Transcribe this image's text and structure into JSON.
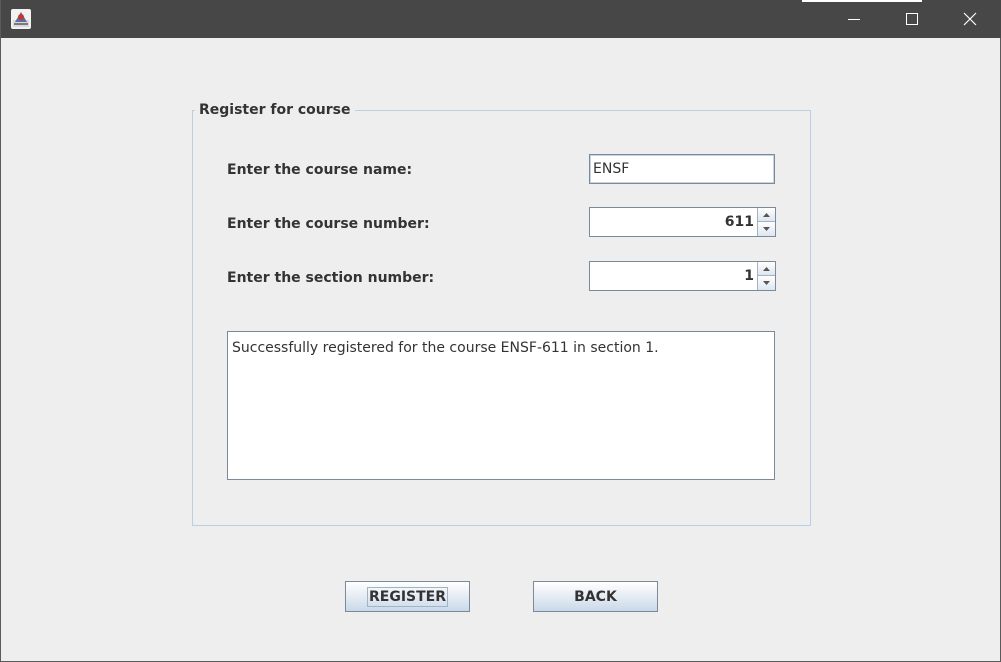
{
  "window": {
    "icon": "java-app-icon",
    "controls": {
      "minimize": "minimize-icon",
      "maximize": "maximize-icon",
      "close": "close-icon"
    }
  },
  "form": {
    "group_title": "Register for course",
    "course_name_label": "Enter the course name:",
    "course_name_value": "ENSF",
    "course_number_label": "Enter the course number:",
    "course_number_value": "611",
    "section_number_label": "Enter the section number:",
    "section_number_value": "1",
    "message": "Successfully registered for the course ENSF-611 in section 1."
  },
  "buttons": {
    "register_label": "REGISTER",
    "back_label": "BACK"
  },
  "colors": {
    "titlebar": "#474747",
    "group_border": "#b8cfe5",
    "button_gradient_end": "#c9d8e8"
  }
}
